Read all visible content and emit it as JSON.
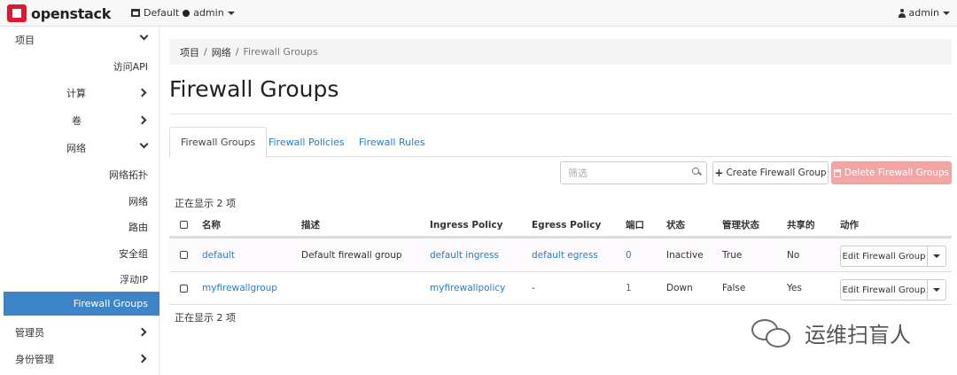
{
  "navbar": {
    "brand": "openstack",
    "domain": "Default",
    "project": "admin",
    "user": "admin"
  },
  "sidebar": {
    "items": [
      {
        "label": "项目",
        "chevron": "down"
      },
      {
        "label": "访问API"
      },
      {
        "label": "计算",
        "chevron": "right"
      },
      {
        "label": "卷",
        "chevron": "right"
      },
      {
        "label": "网络",
        "chevron": "down"
      },
      {
        "label": "网络拓扑"
      },
      {
        "label": "网络"
      },
      {
        "label": "路由"
      },
      {
        "label": "安全组"
      },
      {
        "label": "浮动IP"
      },
      {
        "label": "Firewall Groups",
        "active": true
      },
      {
        "label": "管理员",
        "chevron": "right"
      },
      {
        "label": "身份管理",
        "chevron": "right"
      }
    ]
  },
  "breadcrumb": {
    "items": [
      "项目",
      "网络"
    ],
    "current": "Firewall Groups"
  },
  "page_title": "Firewall Groups",
  "tabs": [
    {
      "label": "Firewall Groups",
      "active": true
    },
    {
      "label": "Firewall Policies"
    },
    {
      "label": "Firewall Rules"
    }
  ],
  "toolbar": {
    "filter_placeholder": "筛选",
    "create_label": "Create Firewall Group",
    "delete_label": "Delete Firewall Groups"
  },
  "count_text": "正在显示 2 项",
  "table": {
    "headers": [
      "名称",
      "描述",
      "Ingress Policy",
      "Egress Policy",
      "端口",
      "状态",
      "管理状态",
      "共享的",
      "动作"
    ],
    "rows": [
      {
        "name": "default",
        "description": "Default firewall group",
        "ingress": "default ingress",
        "egress": "default egress",
        "ports": "0",
        "status": "Inactive",
        "admin_state": "True",
        "shared": "No",
        "action": "Edit Firewall Group"
      },
      {
        "name": "myfirewallgroup",
        "description": "",
        "ingress": "myfirewallpolicy",
        "egress": "-",
        "ports": "1",
        "status": "Down",
        "admin_state": "False",
        "shared": "Yes",
        "action": "Edit Firewall Group"
      }
    ]
  },
  "watermark": "运维扫盲人",
  "colors": {
    "accent": "#3d85c6",
    "link": "#2a7cbf",
    "brand_red": "#da1a32",
    "danger": "#f1a5a5"
  }
}
